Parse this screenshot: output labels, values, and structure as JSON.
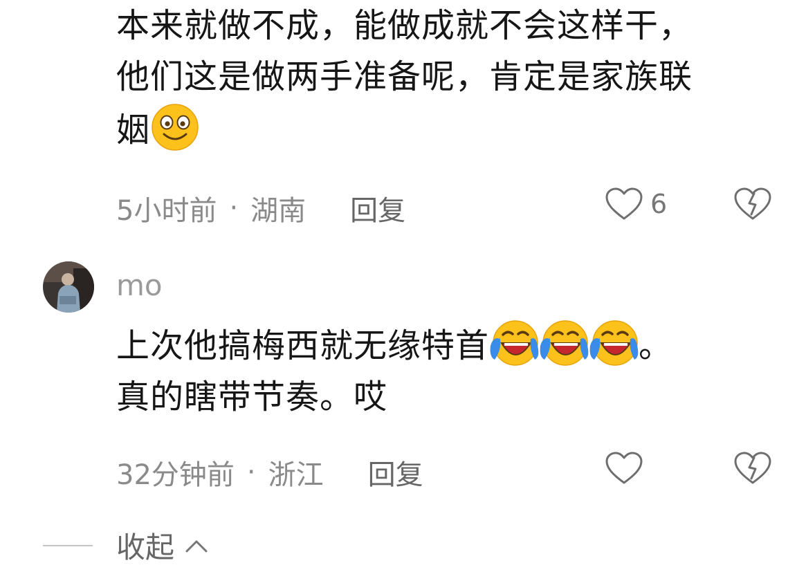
{
  "comment1": {
    "text_line1": "本来就做不成，能做成就不会这样干，",
    "text_line2": "他们这是做两手准备呢，肯定是家族联",
    "text_line3": "姻",
    "emoji": "smile-emoji",
    "time": "5小时前",
    "separator": "·",
    "location": "湖南",
    "reply_label": "回复",
    "like_count": "6"
  },
  "comment2": {
    "username": "mo",
    "text_line1": "上次他搞梅西就无缘特首",
    "text_line1_end": "。",
    "text_line2": "真的瞎带节奏。哎",
    "emoji": "tears-of-joy-emoji",
    "time": "32分钟前",
    "separator": "·",
    "location": "浙江",
    "reply_label": "回复"
  },
  "collapse": {
    "label": "收起",
    "icon": "chevron-up-icon"
  },
  "colors": {
    "meta_gray": "#8a8a8a",
    "emoji_yellow": "#fcc21b",
    "emoji_blue": "#3b8bea"
  }
}
